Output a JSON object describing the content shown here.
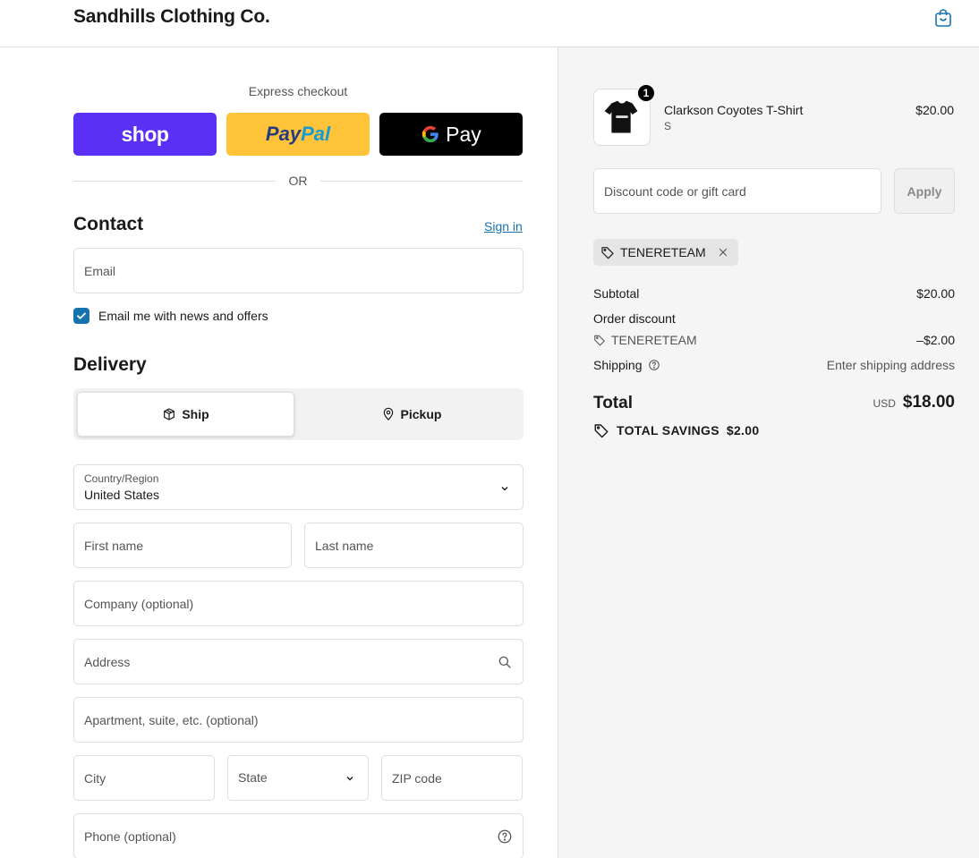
{
  "header": {
    "brand": "Sandhills Clothing Co.",
    "cart_icon": "shopping-bag-icon"
  },
  "express": {
    "label": "Express checkout",
    "shop_label": "shop",
    "paypal_label_1": "Pay",
    "paypal_label_2": "Pal",
    "gpay_label": "Pay",
    "or_label": "OR"
  },
  "contact": {
    "title": "Contact",
    "sign_in": "Sign in",
    "email_placeholder": "Email",
    "news_checkbox_label": "Email me with news and offers",
    "news_checked": true
  },
  "delivery": {
    "title": "Delivery",
    "options": [
      {
        "label": "Ship",
        "icon": "box-icon",
        "selected": true
      },
      {
        "label": "Pickup",
        "icon": "map-pin-icon",
        "selected": false
      }
    ],
    "country_label": "Country/Region",
    "country_value": "United States",
    "first_name": "First name",
    "last_name": "Last name",
    "company": "Company (optional)",
    "address": "Address",
    "apartment": "Apartment, suite, etc. (optional)",
    "city": "City",
    "state": "State",
    "zip": "ZIP code",
    "phone": "Phone (optional)"
  },
  "summary": {
    "product": {
      "name": "Clarkson Coyotes T-Shirt",
      "variant": "S",
      "price": "$20.00",
      "quantity": "1"
    },
    "discount_placeholder": "Discount code or gift card",
    "apply_label": "Apply",
    "applied_code": "TENERETEAM",
    "subtotal_label": "Subtotal",
    "subtotal_value": "$20.00",
    "order_discount_label": "Order discount",
    "discount_code": "TENERETEAM",
    "discount_value": "–$2.00",
    "shipping_label": "Shipping",
    "shipping_value": "Enter shipping address",
    "total_label": "Total",
    "total_currency": "USD",
    "total_value": "$18.00",
    "savings_label": "TOTAL SAVINGS",
    "savings_value": "$2.00"
  },
  "colors": {
    "accent": "#1773b0",
    "shop": "#5a31f4",
    "paypal": "#ffc439",
    "gpay": "#000000"
  }
}
